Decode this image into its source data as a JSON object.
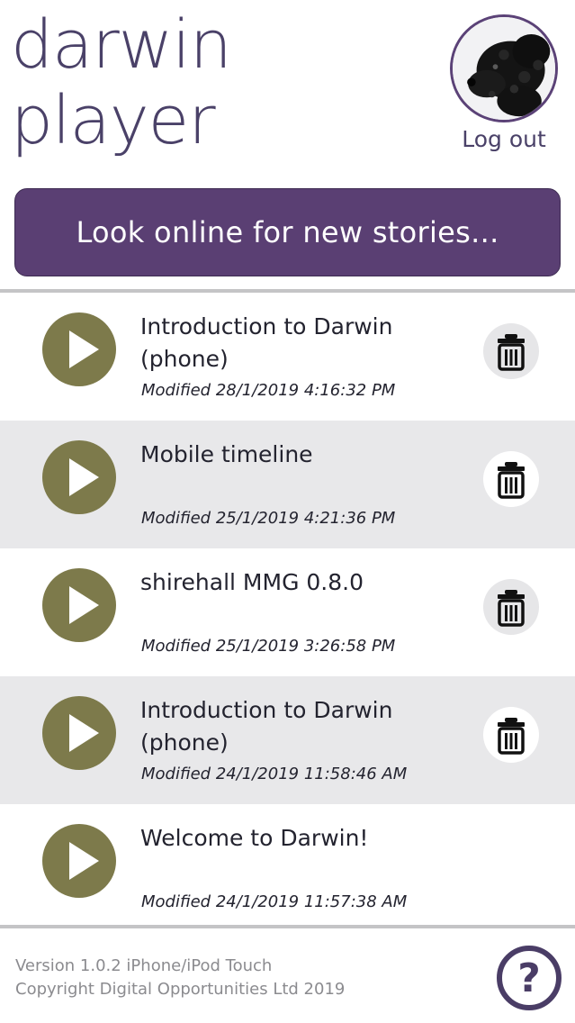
{
  "header": {
    "title_line1": "darwin",
    "title_line2": "player",
    "avatar_icon": "dog-avatar",
    "logout_label": "Log out"
  },
  "online_button": {
    "label": "Look online for new stories..."
  },
  "stories": [
    {
      "title": "Introduction to Darwin (phone)",
      "modified": "Modified 28/1/2019 4:16:32 PM"
    },
    {
      "title": "Mobile timeline",
      "modified": "Modified 25/1/2019 4:21:36 PM"
    },
    {
      "title": "shirehall MMG 0.8.0",
      "modified": "Modified 25/1/2019 3:26:58 PM"
    },
    {
      "title": "Introduction to Darwin (phone)",
      "modified": "Modified 24/1/2019 11:58:46 AM"
    },
    {
      "title": "Welcome to Darwin!",
      "modified": "Modified 24/1/2019 11:57:38 AM"
    }
  ],
  "icons": {
    "play": "play-icon",
    "delete": "trash-icon",
    "help": "help-icon"
  },
  "footer": {
    "version": "Version 1.0.2 iPhone/iPod Touch",
    "copyright": "Copyright Digital Opportunities Ltd 2019",
    "help_label": "?"
  },
  "colors": {
    "brand_purple": "#5a3f73",
    "title_text": "#4a4168",
    "play_olive": "#7d7a4b",
    "alt_row": "#e8e8ea"
  }
}
